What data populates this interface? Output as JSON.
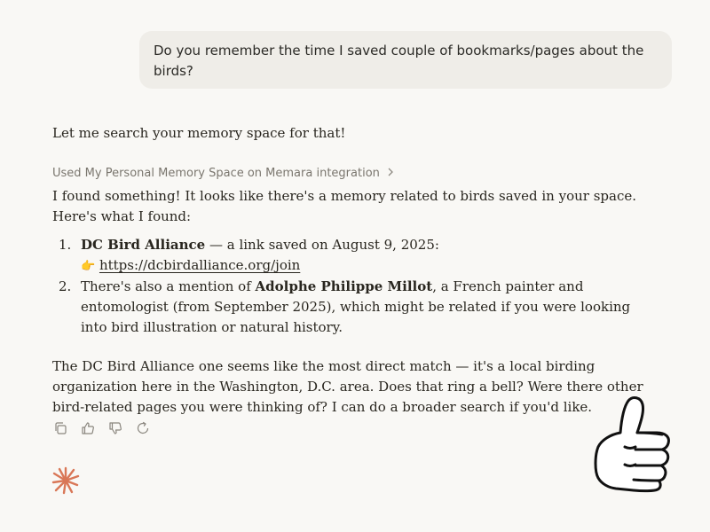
{
  "user_message": "Do you remember the time I saved couple of bookmarks/pages about the birds?",
  "assistant": {
    "intro": "Let me search your memory space for that!",
    "tool_use_label": "Used My Personal Memory Space on Memara integration",
    "found_text": "I found something! It looks like there's a memory related to birds saved in your space. Here's what I found:",
    "results": [
      {
        "number": "1.",
        "title": "DC Bird Alliance",
        "text": " — a link saved on August 9, 2025: ",
        "emoji": "👉",
        "link": "https://dcbirdalliance.org/join"
      },
      {
        "number": "2.",
        "prefix": "There's also a mention of ",
        "title": "Adolphe Philippe Millot",
        "suffix": ", a French painter and entomologist (from September 2025), which might be related if you were looking into bird illustration or natural history."
      }
    ],
    "closing": "The DC Bird Alliance one seems like the most direct match — it's a local birding organization here in the Washington, D.C. area. Does that ring a bell? Were there other bird-related pages you were thinking of? I can do a broader search if you'd like."
  },
  "actions": [
    {
      "name": "copy-icon"
    },
    {
      "name": "thumbs-up-icon"
    },
    {
      "name": "thumbs-down-icon"
    },
    {
      "name": "retry-icon"
    }
  ],
  "colors": {
    "background": "#f9f8f5",
    "user_bubble": "#efede8",
    "text": "#29261f",
    "muted": "#7a766e",
    "brand_spark": "#d97757"
  }
}
